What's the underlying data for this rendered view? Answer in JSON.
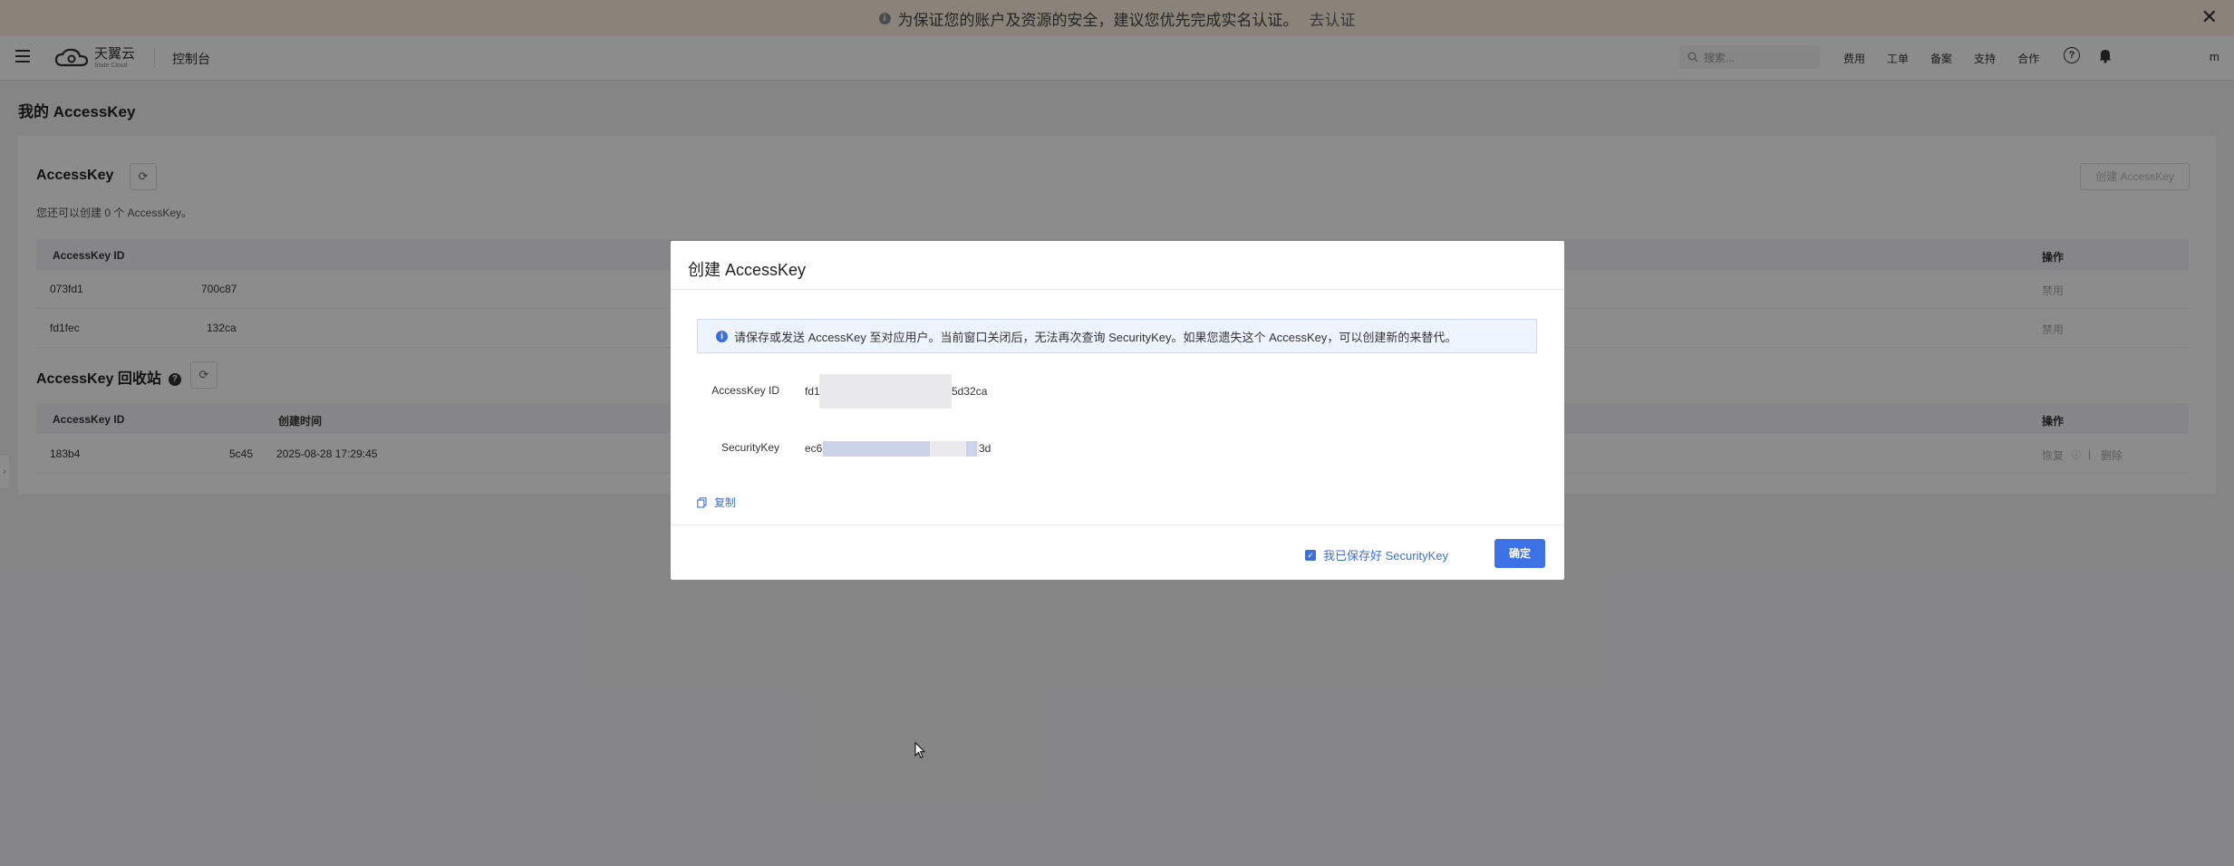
{
  "banner": {
    "text": "为保证您的账户及资源的安全，建议您优先完成实名认证。",
    "link": "去认证",
    "close": "✕"
  },
  "topnav": {
    "logo_cn": "天翼云",
    "logo_en": "State Cloud",
    "console": "控制台",
    "search_placeholder": "搜索...",
    "links": [
      "费用",
      "工单",
      "备案",
      "支持",
      "合作"
    ],
    "help": "?",
    "user": "m"
  },
  "page": {
    "title": "我的 AccessKey"
  },
  "accesskey": {
    "title": "AccessKey",
    "create_button": "创建 AccessKey",
    "hint": "您还可以创建 0 个 AccessKey。",
    "columns": [
      "AccessKey ID",
      "操作"
    ],
    "rows": [
      {
        "id_prefix": "073fd1",
        "id_suffix": "700c87",
        "action": "禁用"
      },
      {
        "id_prefix": "fd1fec",
        "id_suffix": "132ca",
        "action": "禁用"
      }
    ]
  },
  "recycle": {
    "title": "AccessKey 回收站",
    "help": "?",
    "columns": [
      "AccessKey ID",
      "创建时间",
      "操作"
    ],
    "rows": [
      {
        "id_prefix": "183b4",
        "id_suffix": "5c45",
        "created": "2025-08-28 17:29:45",
        "restore": "恢复",
        "delete": "删除"
      }
    ]
  },
  "modal": {
    "title": "创建 AccessKey",
    "alert": "请保存或发送 AccessKey 至对应用户。当前窗口关闭后，无法再次查询 SecurityKey。如果您遗失这个 AccessKey，可以创建新的来替代。",
    "accesskey_label": "AccessKey ID",
    "accesskey_prefix": "fd1",
    "accesskey_suffix": "5d32ca",
    "securitykey_label": "SecurityKey",
    "securitykey_prefix": "ec6",
    "securitykey_suffix": "3d",
    "copy": "复制",
    "ack": "我已保存好 SecurityKey",
    "ack_checked": true,
    "ok": "确定"
  },
  "colors": {
    "accent": "#3c72e6",
    "banner_bg": "#fbeede",
    "overlay": "rgba(0,0,0,0.45)"
  }
}
